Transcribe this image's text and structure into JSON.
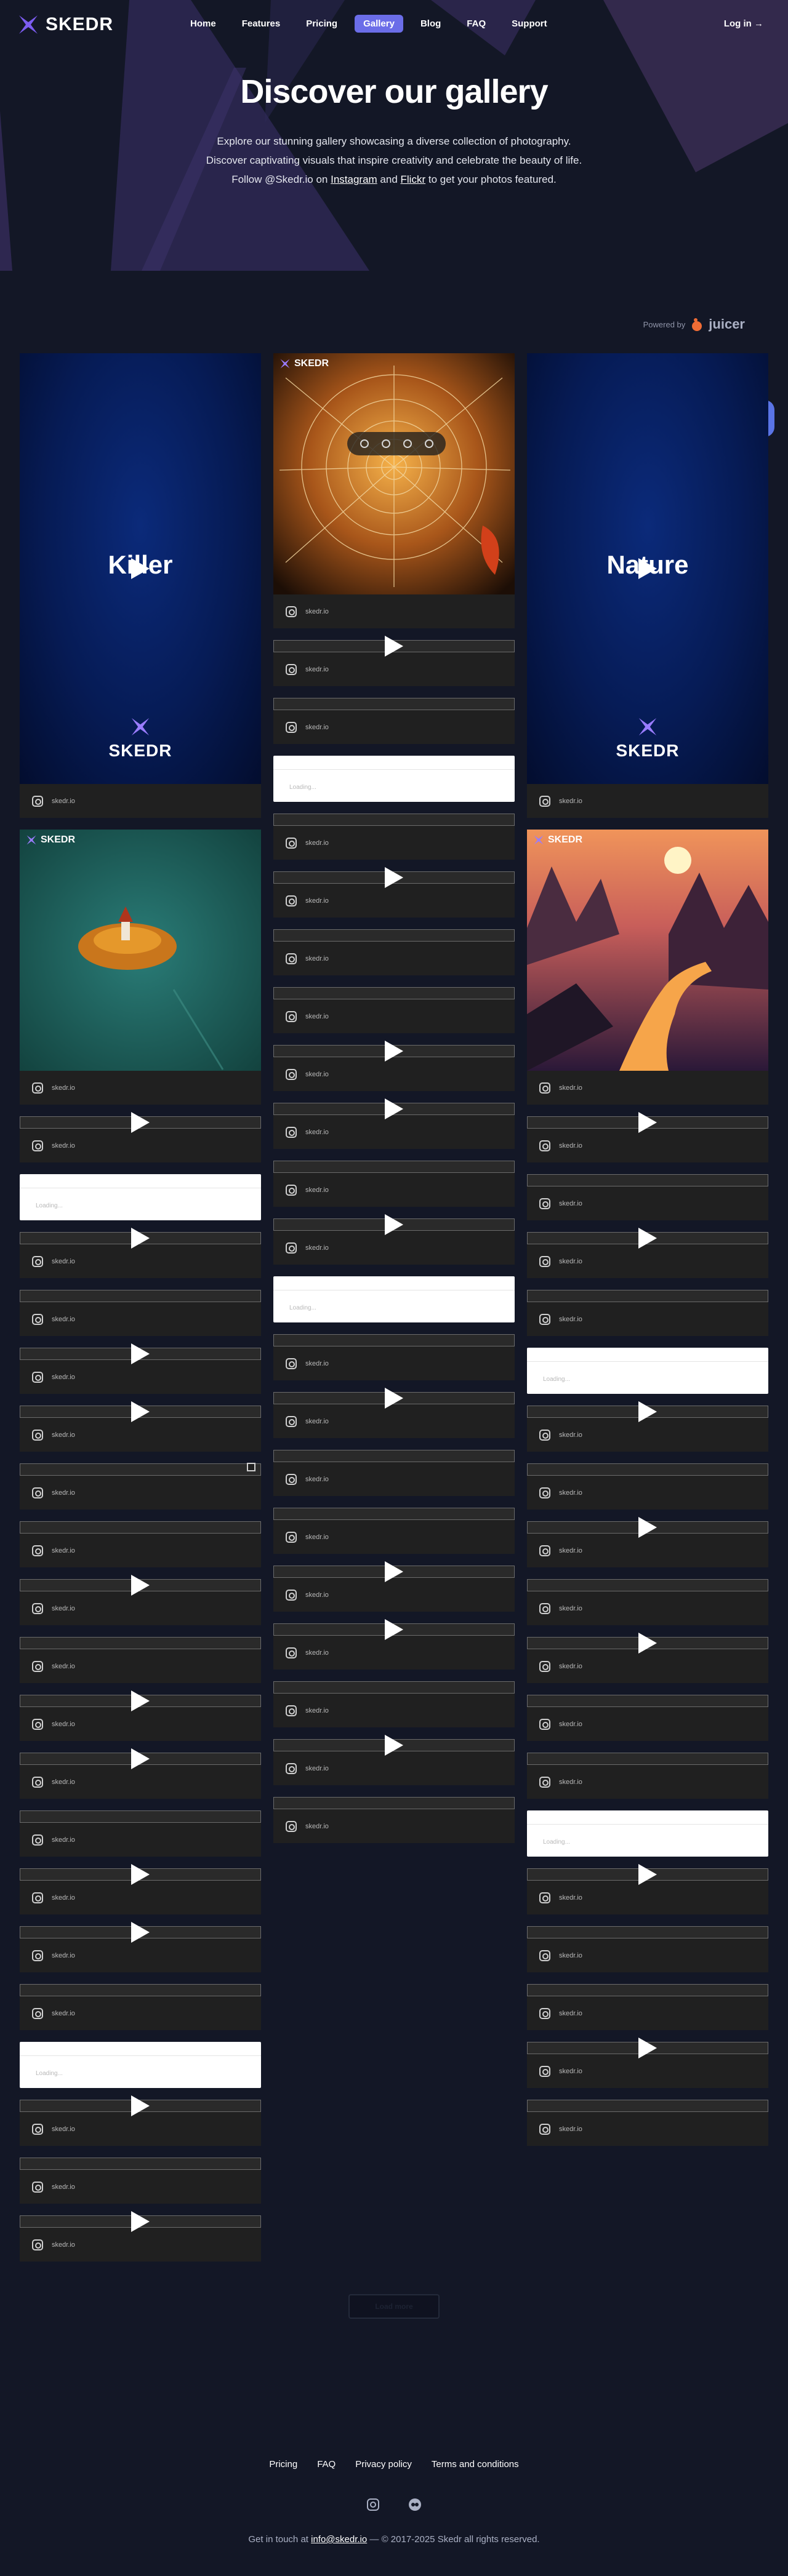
{
  "brand": {
    "name": "SKEDR",
    "accent": "#6b6de8"
  },
  "nav": {
    "items": [
      {
        "label": "Home",
        "active": false
      },
      {
        "label": "Features",
        "active": false
      },
      {
        "label": "Pricing",
        "active": false
      },
      {
        "label": "Gallery",
        "active": true
      },
      {
        "label": "Blog",
        "active": false
      },
      {
        "label": "FAQ",
        "active": false
      },
      {
        "label": "Support",
        "active": false
      }
    ],
    "login": "Log in →"
  },
  "hero": {
    "title": "Discover our gallery",
    "line1": "Explore our stunning gallery showcasing a diverse collection of photography.",
    "line2": "Discover captivating visuals that inspire creativity and celebrate the beauty of life.",
    "line3_pre": "Follow @Skedr.io on ",
    "line3_link1": "Instagram",
    "line3_mid": " and ",
    "line3_link2": "Flickr",
    "line3_post": " to get your photos featured."
  },
  "powered": {
    "label": "Powered by",
    "name": "juicer"
  },
  "feed": {
    "username": "skedr.io",
    "card_logo": "SKEDR",
    "video_brand": "SKEDR",
    "white_card_text": "Loading...",
    "col1": [
      "video:Killer",
      "photo:island",
      "line:play",
      "white",
      "line:play",
      "line",
      "line:play",
      "line:play",
      "line:multi",
      "line",
      "line:play",
      "line",
      "line:play",
      "line:play",
      "line",
      "line:play",
      "line:play",
      "line",
      "white",
      "line:play",
      "line",
      "line:play"
    ],
    "col2": [
      "photo:spider",
      "line:play",
      "line",
      "white",
      "line",
      "line:play",
      "line",
      "line",
      "line:play",
      "line:play",
      "line",
      "line:play",
      "white",
      "line",
      "line:play",
      "line",
      "line",
      "line:play",
      "line:play",
      "line",
      "line:play",
      "line"
    ],
    "col3": [
      "video:Nature",
      "photo:sunset",
      "line:play",
      "line",
      "line:play",
      "line",
      "white",
      "line:play",
      "line",
      "line:play",
      "line",
      "line:play",
      "line",
      "line",
      "white",
      "line:play",
      "line",
      "line",
      "line:play",
      "line"
    ]
  },
  "load_more": "Load more",
  "footer": {
    "links": [
      "Pricing",
      "FAQ",
      "Privacy policy",
      "Terms and conditions"
    ],
    "icons": [
      "instagram-icon",
      "flickr-icon"
    ],
    "copy_pre": "Get in touch at ",
    "email": "info@skedr.io",
    "copy_post": " — © 2017-2025 Skedr all rights reserved."
  }
}
